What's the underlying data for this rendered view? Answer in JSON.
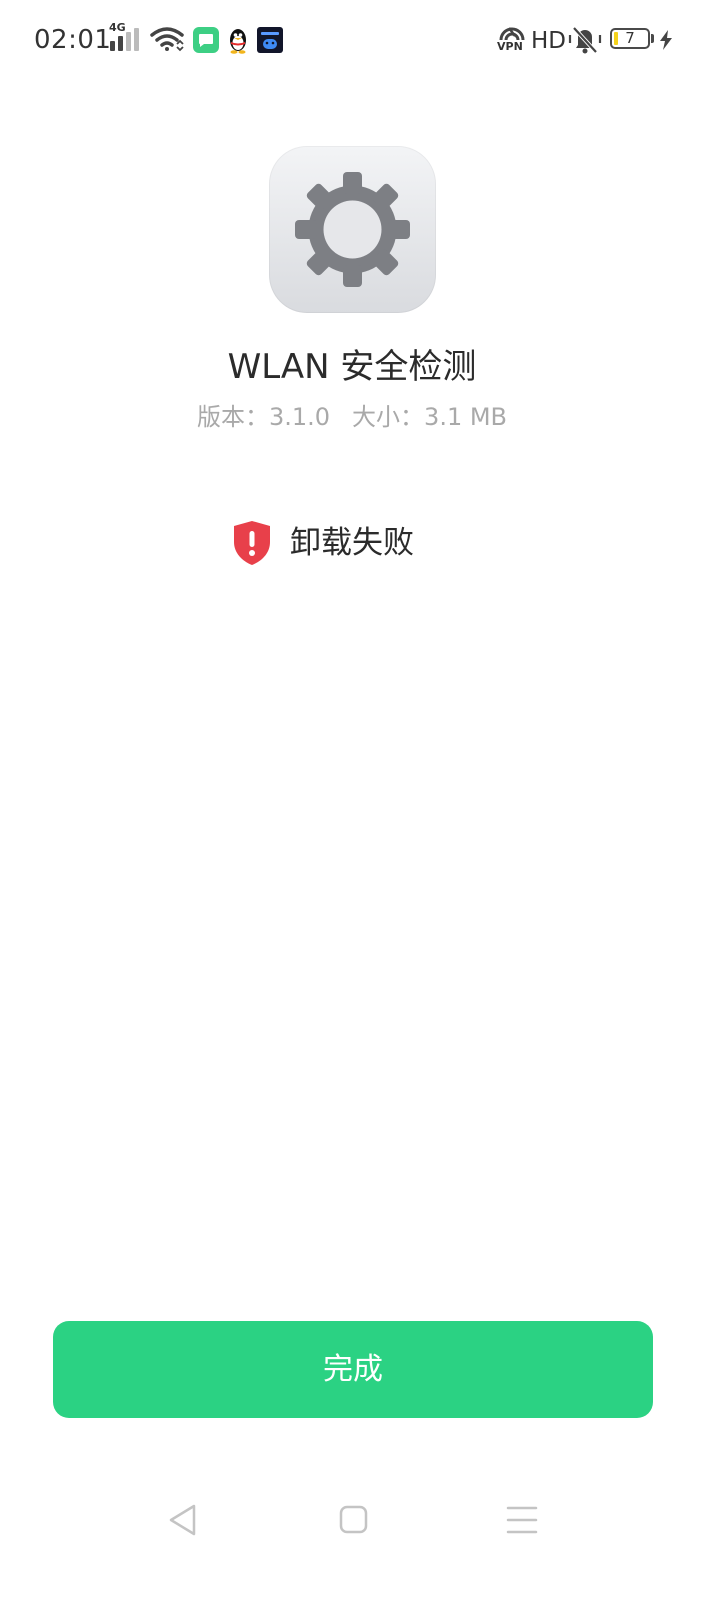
{
  "status_bar": {
    "time": "02:01",
    "network_type": "4G",
    "vpn_label": "VPN",
    "hd_label": "HD",
    "battery_level": "7",
    "icons": [
      "signal-icon",
      "wifi-icon",
      "message-app-icon",
      "qq-penguin-icon",
      "bubble-app-icon",
      "vpn-icon",
      "mute-icon",
      "battery-icon",
      "charging-icon"
    ]
  },
  "app": {
    "icon": "gear-icon",
    "name": "WLAN 安全检测",
    "version_text": "版本：3.1.0",
    "size_text": "大小：3.1 MB"
  },
  "result": {
    "icon": "shield-alert-icon",
    "text": "卸载失败",
    "color": "#e8404a"
  },
  "done_button": {
    "label": "完成",
    "color": "#2bd283"
  },
  "nav_bar": {
    "items": [
      "back-icon",
      "home-icon",
      "recents-icon"
    ]
  }
}
